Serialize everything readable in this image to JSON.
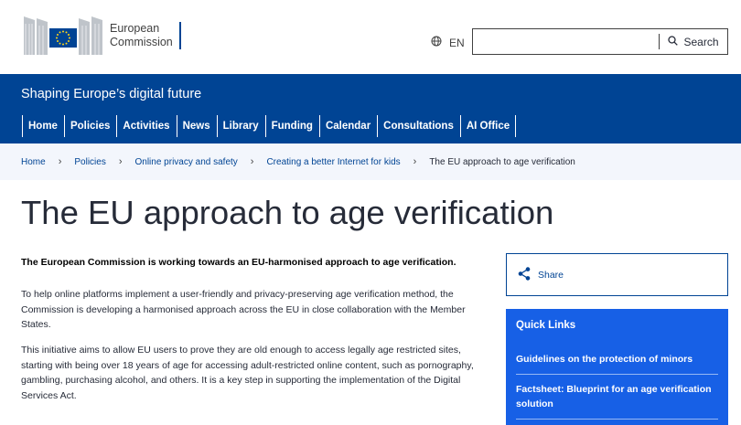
{
  "header": {
    "logo_line1": "European",
    "logo_line2": "Commission",
    "language": "EN",
    "search_placeholder": "",
    "search_button": "Search"
  },
  "band": {
    "site_name": "Shaping Europe’s digital future",
    "nav": [
      "Home",
      "Policies",
      "Activities",
      "News",
      "Library",
      "Funding",
      "Calendar",
      "Consultations",
      "AI Office"
    ]
  },
  "breadcrumb": {
    "links": [
      "Home",
      "Policies",
      "Online privacy and safety",
      "Creating a better Internet for kids"
    ],
    "current": "The EU approach to age verification"
  },
  "page": {
    "title": "The EU approach to age verification",
    "lead": "The European Commission is working towards an EU-harmonised approach to age verification.",
    "para1": "To help online platforms implement a user-friendly and privacy-preserving age verification method, the Commission is developing a harmonised approach across the EU in close collaboration with the Member States.",
    "para2": "This initiative aims to allow EU users to prove they are old enough to access legally age restricted sites, starting with being over 18 years of age for accessing adult-restricted online content, such as pornography, gambling, purchasing alcohol, and others. It is a key step in supporting the implementation of the Digital Services Act."
  },
  "sidebar": {
    "share_label": "Share",
    "quick_links_title": "Quick Links",
    "quick_links": [
      "Guidelines on the protection of minors",
      "Factsheet: Blueprint for an age verification solution"
    ]
  },
  "colors": {
    "brand_blue": "#004494",
    "quick_links_bg": "#1760e6",
    "breadcrumb_bg": "#f3f6fc",
    "flag_star": "#ffd617"
  },
  "icons": {
    "language": "globe-icon",
    "search": "search-icon",
    "breadcrumb_separator": "chevron-right-icon",
    "share": "share-icon"
  }
}
